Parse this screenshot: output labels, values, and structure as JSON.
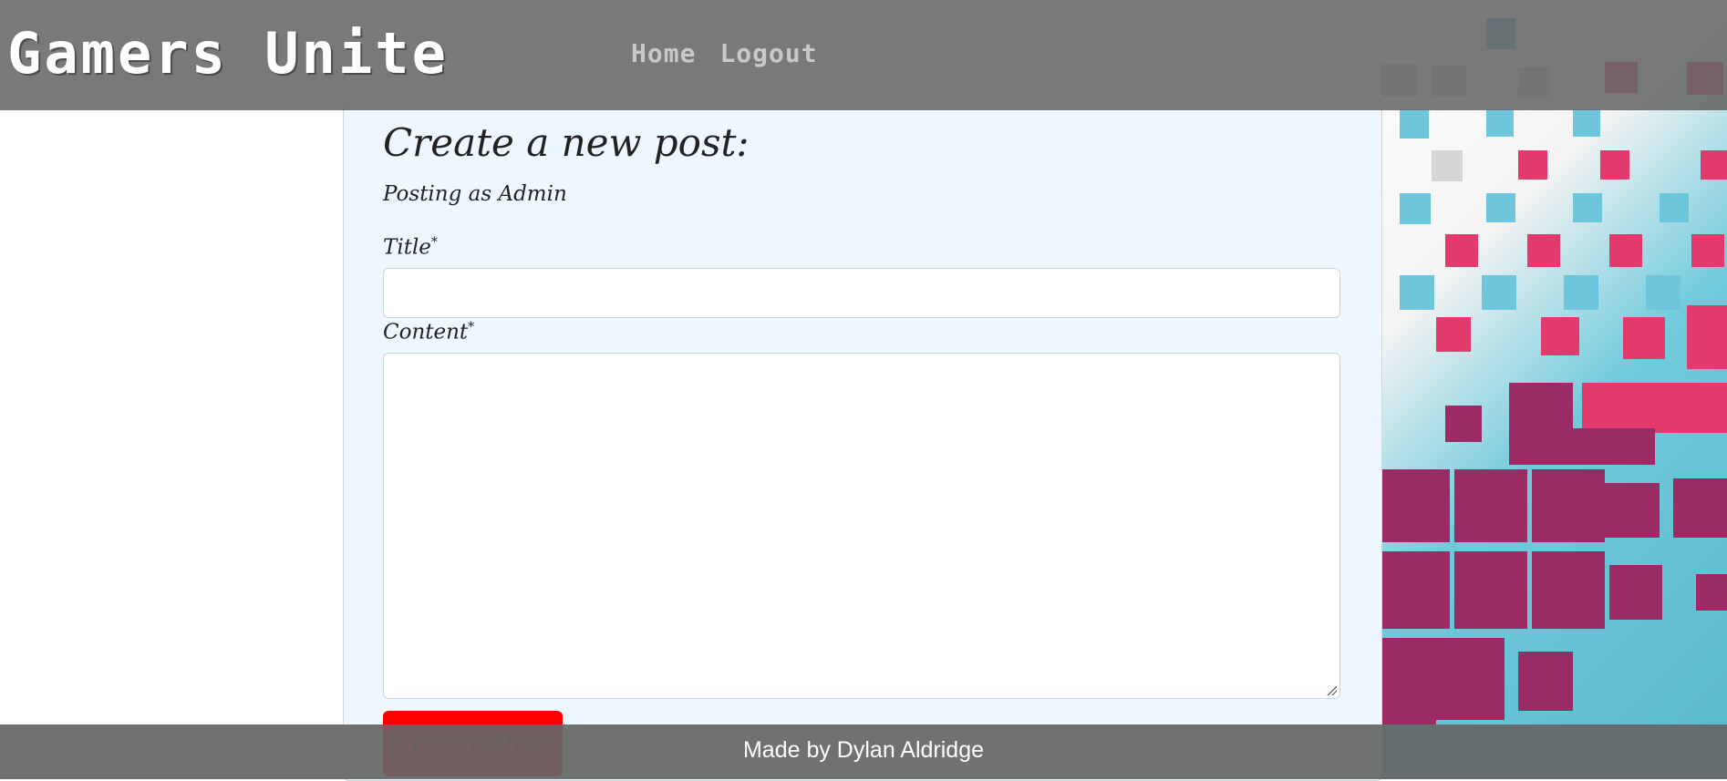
{
  "header": {
    "brand": "Gamers Unite",
    "nav": [
      "Home",
      "Logout"
    ]
  },
  "form": {
    "heading": "Create a new post:",
    "posting_as": "Posting as Admin",
    "title_label": "Title",
    "content_label": "Content",
    "required_mark": "*",
    "title_value": "",
    "content_value": "",
    "submit_label": "Create Post"
  },
  "footer": {
    "text": "Made by Dylan Aldridge"
  },
  "colors": {
    "header_bg": "#666666",
    "card_bg": "#eef6ff",
    "submit_bg": "#ff0000",
    "submit_text": "#7a0000"
  }
}
